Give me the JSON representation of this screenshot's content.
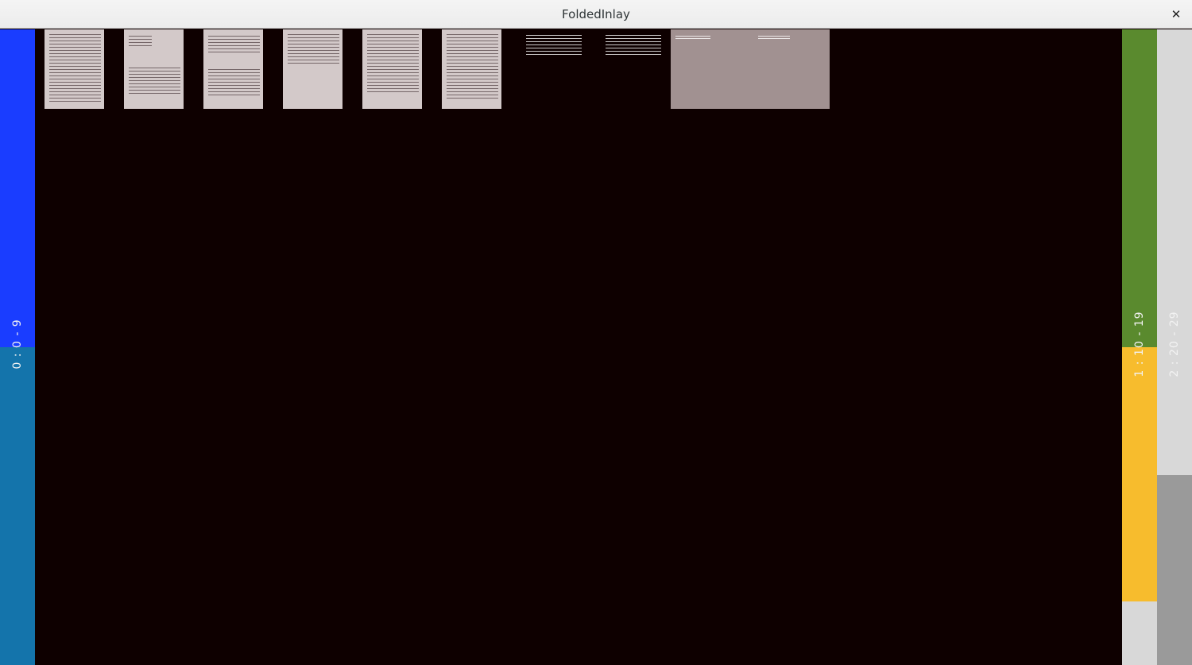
{
  "window": {
    "title": "FoldedInlay",
    "close_glyph": "✕"
  },
  "strips": {
    "left": {
      "label": "0 : 0 - 9",
      "colors": [
        "#1a3dff",
        "#1474ab"
      ]
    },
    "right_inner": {
      "label": "1 : 10 - 19",
      "colors": [
        "#5a8a2e",
        "#f7bc2d",
        "#d8d8d8"
      ]
    },
    "right_outer": {
      "label": "2 : 20 - 29",
      "colors": [
        "#d8d8d8",
        "#9a9a9a"
      ]
    }
  },
  "thumbnails": [
    {
      "name": "page-1",
      "style": "light"
    },
    {
      "name": "page-2",
      "style": "light"
    },
    {
      "name": "page-3",
      "style": "light"
    },
    {
      "name": "page-4",
      "style": "light"
    },
    {
      "name": "page-5",
      "style": "light"
    },
    {
      "name": "page-6",
      "style": "light"
    },
    {
      "name": "page-7",
      "style": "dark"
    },
    {
      "name": "page-8",
      "style": "dark"
    },
    {
      "name": "page-9",
      "style": "wide"
    }
  ]
}
